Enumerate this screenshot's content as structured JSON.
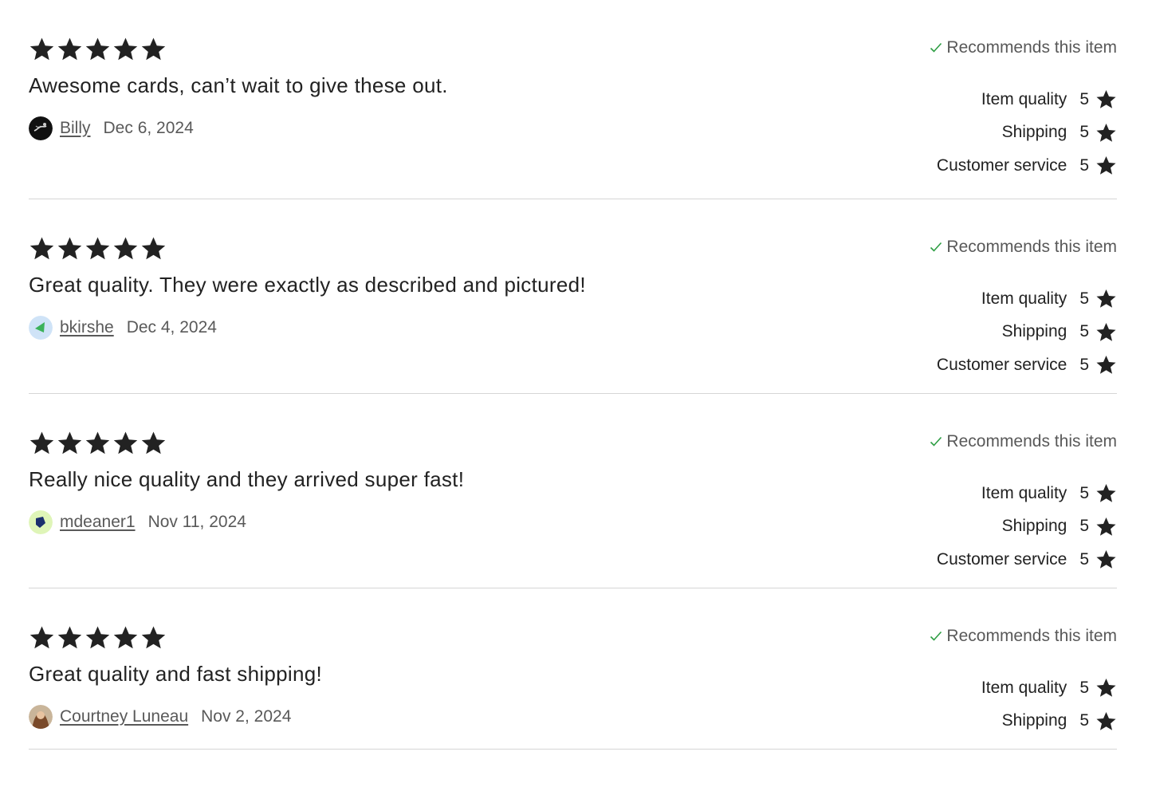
{
  "colors": {
    "star": "#222222",
    "check": "#2e9e44",
    "divider": "#d6d6d6",
    "muted_text": "#595959"
  },
  "reviews": [
    {
      "rating": 5,
      "text": "Awesome cards, can’t wait to give these out.",
      "username": "Billy",
      "date": "Dec 6, 2024",
      "avatar_icon": "avatar-billy-icon",
      "recommends": "Recommends this item",
      "subratings": [
        {
          "label": "Item quality",
          "value": "5"
        },
        {
          "label": "Shipping",
          "value": "5"
        },
        {
          "label": "Customer service",
          "value": "5"
        }
      ]
    },
    {
      "rating": 5,
      "text": "Great quality. They were exactly as described and pictured!",
      "username": "bkirshe",
      "date": "Dec 4, 2024",
      "avatar_icon": "avatar-bkirshe-icon",
      "recommends": "Recommends this item",
      "subratings": [
        {
          "label": "Item quality",
          "value": "5"
        },
        {
          "label": "Shipping",
          "value": "5"
        },
        {
          "label": "Customer service",
          "value": "5"
        }
      ]
    },
    {
      "rating": 5,
      "text": "Really nice quality and they arrived super fast!",
      "username": "mdeaner1",
      "date": "Nov 11, 2024",
      "avatar_icon": "avatar-mdeaner1-icon",
      "recommends": "Recommends this item",
      "subratings": [
        {
          "label": "Item quality",
          "value": "5"
        },
        {
          "label": "Shipping",
          "value": "5"
        },
        {
          "label": "Customer service",
          "value": "5"
        }
      ]
    },
    {
      "rating": 5,
      "text": "Great quality and fast shipping!",
      "username": "Courtney Luneau",
      "date": "Nov 2, 2024",
      "avatar_icon": "avatar-courtney-luneau-icon",
      "recommends": "Recommends this item",
      "subratings": [
        {
          "label": "Item quality",
          "value": "5"
        },
        {
          "label": "Shipping",
          "value": "5"
        }
      ]
    }
  ]
}
